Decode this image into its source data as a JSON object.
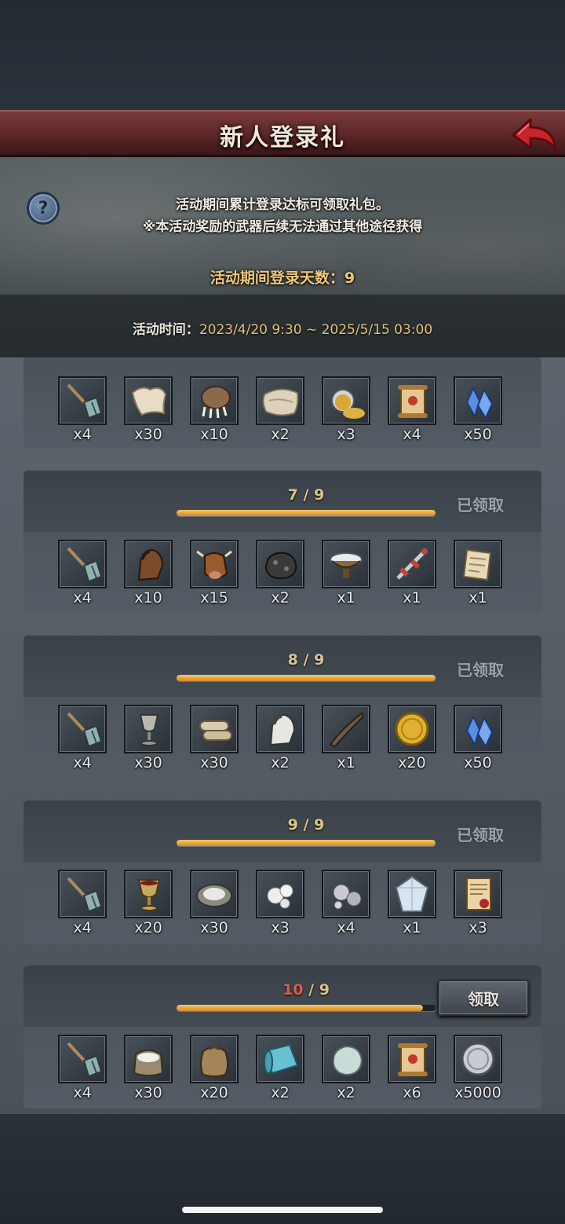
{
  "header": {
    "title": "新人登录礼"
  },
  "banner": {
    "desc_line1": "活动期间累计登录达标可领取礼包。",
    "desc_line2": "※本活动奖励的武器后续无法通过其他途径获得",
    "login_days": "活动期间登录天数：9",
    "time_label": "活动时间：",
    "time_value": "2023/4/20 9:30 ~ 2025/5/15 03:00"
  },
  "colors": {
    "accent_gold": "#e6c27a",
    "progress_fill": "#e0a23a",
    "over_red": "#e05a4f",
    "title_red": "#5a2426"
  },
  "rewards": [
    {
      "progress_current": null,
      "progress_total": null,
      "status": "",
      "items": [
        {
          "icon": "shovel-icon",
          "qty": "x4"
        },
        {
          "icon": "fur-pelt-icon",
          "qty": "x30"
        },
        {
          "icon": "claw-paw-icon",
          "qty": "x10"
        },
        {
          "icon": "bone-pelt-icon",
          "qty": "x2"
        },
        {
          "icon": "gold-potion-icon",
          "qty": "x3"
        },
        {
          "icon": "scroll-icon",
          "qty": "x4"
        },
        {
          "icon": "blue-crystal-icon",
          "qty": "x50"
        }
      ]
    },
    {
      "progress_current": "7",
      "progress_total": "9",
      "progress_fraction": 1.0,
      "status": "已领取",
      "items": [
        {
          "icon": "shovel-icon",
          "qty": "x4"
        },
        {
          "icon": "horse-head-icon",
          "qty": "x10"
        },
        {
          "icon": "cow-head-icon",
          "qty": "x15"
        },
        {
          "icon": "coal-ore-icon",
          "qty": "x2"
        },
        {
          "icon": "salt-bowl-icon",
          "qty": "x1"
        },
        {
          "icon": "ornate-sword-icon",
          "qty": "x1"
        },
        {
          "icon": "blueprint-paper-icon",
          "qty": "x1"
        }
      ]
    },
    {
      "progress_current": "8",
      "progress_total": "9",
      "progress_fraction": 1.0,
      "status": "已领取",
      "items": [
        {
          "icon": "shovel-icon",
          "qty": "x4"
        },
        {
          "icon": "goblet-icon",
          "qty": "x30"
        },
        {
          "icon": "paper-rolls-icon",
          "qty": "x30"
        },
        {
          "icon": "white-horse-icon",
          "qty": "x2"
        },
        {
          "icon": "horn-icon",
          "qty": "x1"
        },
        {
          "icon": "gold-coin-icon",
          "qty": "x20"
        },
        {
          "icon": "blue-crystal-icon",
          "qty": "x50"
        }
      ]
    },
    {
      "progress_current": "9",
      "progress_total": "9",
      "progress_fraction": 1.0,
      "status": "已领取",
      "items": [
        {
          "icon": "shovel-icon",
          "qty": "x4"
        },
        {
          "icon": "wine-goblet-icon",
          "qty": "x20"
        },
        {
          "icon": "oyster-icon",
          "qty": "x30"
        },
        {
          "icon": "pearls-icon",
          "qty": "x3"
        },
        {
          "icon": "silver-pearls-icon",
          "qty": "x4"
        },
        {
          "icon": "diamond-icon",
          "qty": "x1"
        },
        {
          "icon": "sealed-scroll-icon",
          "qty": "x3"
        }
      ]
    },
    {
      "progress_current": "10",
      "progress_total": "9",
      "progress_fraction": 0.95,
      "status": "领取",
      "items": [
        {
          "icon": "shovel-icon",
          "qty": "x4"
        },
        {
          "icon": "salt-sack-icon",
          "qty": "x30"
        },
        {
          "icon": "grain-sack-icon",
          "qty": "x20"
        },
        {
          "icon": "cloth-roll-icon",
          "qty": "x2"
        },
        {
          "icon": "pale-stone-icon",
          "qty": "x2"
        },
        {
          "icon": "scroll-icon",
          "qty": "x6"
        },
        {
          "icon": "silver-coin-icon",
          "qty": "x5000"
        }
      ]
    }
  ]
}
